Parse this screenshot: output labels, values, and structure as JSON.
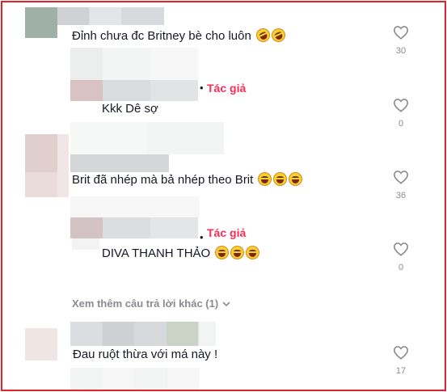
{
  "comments": [
    {
      "text": "Đỉnh chưa đc Britney bè cho luôn",
      "emoji_count": 2,
      "emoji_name": "rolling-laughing",
      "likes": "30"
    },
    {
      "text": "Kkk Dê sợ",
      "author_badge": "Tác giả",
      "likes": "0"
    },
    {
      "text": "Brit đã nhép mà bả nhép theo Brit",
      "emoji_count": 3,
      "emoji_name": "grinning-squint",
      "likes": "36"
    },
    {
      "text": "DIVA THANH THẢO",
      "author_badge": "Tác giả",
      "emoji_count": 3,
      "emoji_name": "grinning-squint",
      "likes": "0"
    },
    {
      "text": "Đau ruột thừa với má này !",
      "likes": "17"
    }
  ],
  "view_more": {
    "label": "Xem thêm câu trả lời khác (1)",
    "icon": "chevron-down-icon"
  },
  "like_icon": "heart-outline-icon",
  "colors": {
    "border": "#e0242a",
    "author": "#fe2c55",
    "muted": "#8a8b91"
  }
}
